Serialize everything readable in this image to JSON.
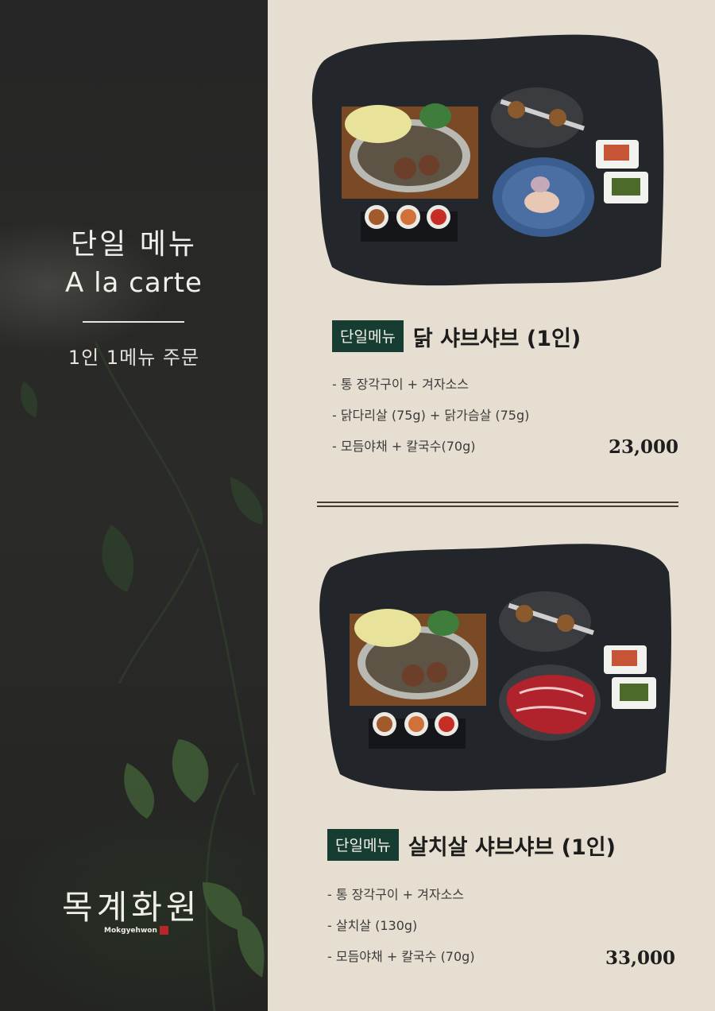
{
  "panel": {
    "title_ko": "단일 메뉴",
    "title_en": "A la carte",
    "subtitle": "1인 1메뉴 주문",
    "brand": "목계화원",
    "brand_en": "Mokgyehwon"
  },
  "items": [
    {
      "tag": "단일메뉴",
      "name": "닭 샤브샤브 (1인)",
      "details": [
        "- 통 장각구이 + 겨자소스",
        "- 닭다리살 (75g) + 닭가슴살 (75g)",
        "- 모듬야채 + 칼국수(70g)"
      ],
      "price": "23,000",
      "photo_icon": "chicken-shabu-photo"
    },
    {
      "tag": "단일메뉴",
      "name": "살치살 샤브샤브 (1인)",
      "details": [
        "- 통 장각구이 + 겨자소스",
        "- 살치살 (130g)",
        "- 모듬야채 + 칼국수 (70g)"
      ],
      "price": "33,000",
      "photo_icon": "beef-shabu-photo"
    }
  ],
  "colors": {
    "background": "#e6dfd1",
    "panel": "#262626",
    "tag": "#173c31",
    "divider": "#4a3c33"
  }
}
